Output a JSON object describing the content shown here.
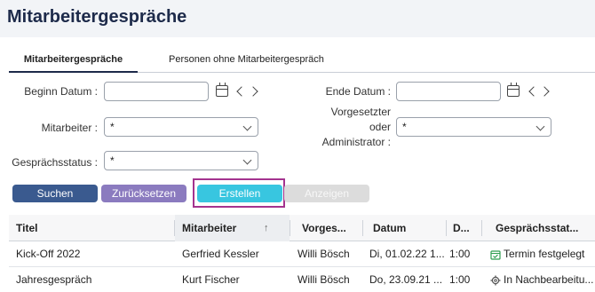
{
  "page": {
    "title": "Mitarbeitergespräche"
  },
  "tabs": [
    {
      "label": "Mitarbeitergespräche",
      "active": true
    },
    {
      "label": "Personen ohne Mitarbeitergespräch",
      "active": false
    }
  ],
  "filters": {
    "begin_date_label": "Beginn Datum :",
    "end_date_label": "Ende Datum :",
    "employee_label": "Mitarbeiter :",
    "employee_value": "*",
    "supervisor_label_1": "Vorgesetzter",
    "supervisor_label_2": "oder",
    "supervisor_label_3": "Administrator :",
    "supervisor_value": "*",
    "status_label": "Gesprächsstatus :",
    "status_value": "*"
  },
  "buttons": {
    "search": "Suchen",
    "reset": "Zurücksetzen",
    "create": "Erstellen",
    "show": "Anzeigen"
  },
  "table": {
    "headers": [
      "Titel",
      "Mitarbeiter",
      "Vorges...",
      "Datum",
      "D...",
      "Gesprächsstat..."
    ],
    "rows": [
      {
        "title": "Kick-Off 2022",
        "employee": "Gerfried Kessler",
        "supervisor": "Willi Bösch",
        "date": "Di, 01.02.22 1...",
        "duration": "1:00",
        "status": "Termin festgelegt"
      },
      {
        "title": "Jahresgespräch",
        "employee": "Kurt Fischer",
        "supervisor": "Willi Bösch",
        "date": "Do, 23.09.21 ...",
        "duration": "1:00",
        "status": "In Nachbearbeitu..."
      }
    ]
  },
  "colors": {
    "primary": "#3a5a8f",
    "secondary": "#8b7bbf",
    "create": "#38c6e0",
    "disabled": "#dcdcdc",
    "highlight": "#a4338f",
    "status_scheduled": "#2e9e4f"
  }
}
